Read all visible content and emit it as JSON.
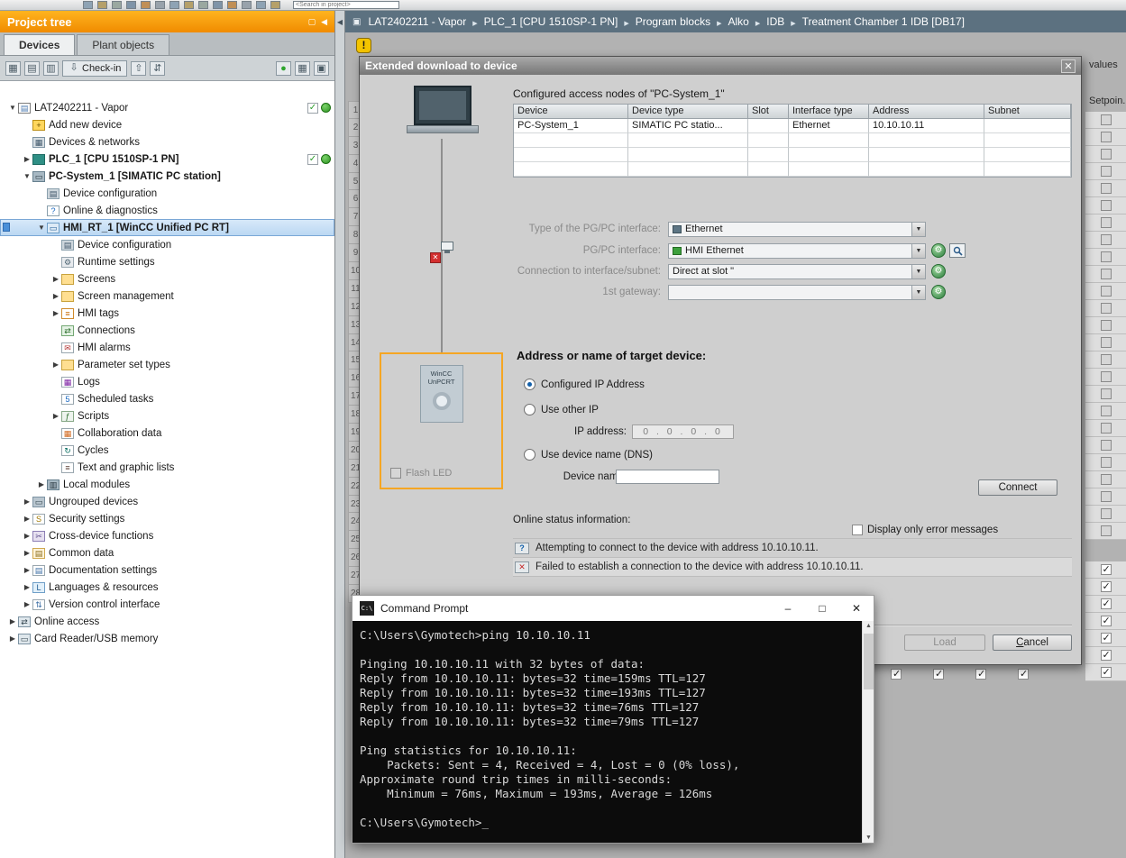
{
  "top_toolbar": {
    "search_placeholder": "<Search in project>",
    "icons": [
      "save-project-icon",
      "print-icon",
      "cut-icon",
      "copy-icon",
      "paste-icon",
      "undo-icon",
      "redo-icon",
      "compile-icon",
      "download-to-device-icon",
      "upload-from-device-icon",
      "start-simulation-icon",
      "go-online-icon",
      "go-offline-icon",
      "diagnostics-icon"
    ]
  },
  "breadcrumb": {
    "items": [
      "LAT2402211 - Vapor",
      "PLC_1 [CPU 1510SP-1 PN]",
      "Program blocks",
      "Alko",
      "IDB",
      "Treatment Chamber 1 IDB [DB17]"
    ]
  },
  "project_tree": {
    "title": "Project tree",
    "tabs": [
      {
        "label": "Devices",
        "active": true
      },
      {
        "label": "Plant objects",
        "active": false
      }
    ],
    "toolbar": {
      "icons_left": [
        "filter-icon",
        "open-element-icon",
        "close-element-icon"
      ],
      "checkin_label": "Check-in",
      "icons_mid": [
        "checkout-icon",
        "sync-icon"
      ],
      "icons_right": [
        "online-status-icon",
        "table-view-icon",
        "window-view-icon"
      ]
    },
    "items": [
      {
        "label": "LAT2402211 - Vapor",
        "level": 0,
        "icon": "project-icon",
        "expander": "expanded",
        "status": [
          "check",
          "circle"
        ]
      },
      {
        "label": "Add new device",
        "level": 1,
        "icon": "add-device-icon"
      },
      {
        "label": "Devices & networks",
        "level": 1,
        "icon": "network-icon"
      },
      {
        "label": "PLC_1 [CPU 1510SP-1 PN]",
        "level": 1,
        "icon": "plc-icon",
        "expander": "collapsed",
        "bold": true,
        "status": [
          "check",
          "circle"
        ]
      },
      {
        "label": "PC-System_1 [SIMATIC PC station]",
        "level": 1,
        "icon": "pc-station-icon",
        "expander": "expanded",
        "bold": true
      },
      {
        "label": "Device configuration",
        "level": 2,
        "icon": "device-config-icon"
      },
      {
        "label": "Online & diagnostics",
        "level": 2,
        "icon": "diagnostics-icon"
      },
      {
        "label": "HMI_RT_1 [WinCC Unified PC RT]",
        "level": 2,
        "icon": "hmi-rt-icon",
        "expander": "expanded",
        "bold": true,
        "selected": true
      },
      {
        "label": "Device configuration",
        "level": 3,
        "icon": "device-config-icon"
      },
      {
        "label": "Runtime settings",
        "level": 3,
        "icon": "runtime-settings-icon"
      },
      {
        "label": "Screens",
        "level": 3,
        "icon": "folder-icon",
        "expander": "collapsed"
      },
      {
        "label": "Screen management",
        "level": 3,
        "icon": "folder-icon",
        "expander": "collapsed"
      },
      {
        "label": "HMI tags",
        "level": 3,
        "icon": "hmi-tags-icon",
        "expander": "collapsed"
      },
      {
        "label": "Connections",
        "level": 3,
        "icon": "connections-icon"
      },
      {
        "label": "HMI alarms",
        "level": 3,
        "icon": "hmi-alarms-icon"
      },
      {
        "label": "Parameter set types",
        "level": 3,
        "icon": "folder-icon",
        "expander": "collapsed"
      },
      {
        "label": "Logs",
        "level": 3,
        "icon": "logs-icon"
      },
      {
        "label": "Scheduled tasks",
        "level": 3,
        "icon": "scheduled-tasks-icon"
      },
      {
        "label": "Scripts",
        "level": 3,
        "icon": "scripts-icon",
        "expander": "collapsed"
      },
      {
        "label": "Collaboration data",
        "level": 3,
        "icon": "collaboration-icon"
      },
      {
        "label": "Cycles",
        "level": 3,
        "icon": "cycles-icon"
      },
      {
        "label": "Text and graphic lists",
        "level": 3,
        "icon": "text-lists-icon"
      },
      {
        "label": "Local modules",
        "level": 2,
        "icon": "local-modules-icon",
        "expander": "collapsed"
      },
      {
        "label": "Ungrouped devices",
        "level": 1,
        "icon": "ungrouped-icon",
        "expander": "collapsed"
      },
      {
        "label": "Security settings",
        "level": 1,
        "icon": "security-icon",
        "expander": "collapsed"
      },
      {
        "label": "Cross-device functions",
        "level": 1,
        "icon": "cross-device-icon",
        "expander": "collapsed"
      },
      {
        "label": "Common data",
        "level": 1,
        "icon": "common-data-icon",
        "expander": "collapsed"
      },
      {
        "label": "Documentation settings",
        "level": 1,
        "icon": "doc-settings-icon",
        "expander": "collapsed"
      },
      {
        "label": "Languages & resources",
        "level": 1,
        "icon": "languages-icon",
        "expander": "collapsed"
      },
      {
        "label": "Version control interface",
        "level": 1,
        "icon": "version-control-icon",
        "expander": "collapsed"
      },
      {
        "label": "Online access",
        "level": 0,
        "icon": "online-access-icon",
        "expander": "collapsed"
      },
      {
        "label": "Card Reader/USB memory",
        "level": 0,
        "icon": "card-reader-icon",
        "expander": "collapsed"
      }
    ]
  },
  "editor": {
    "row_numbers": [
      1,
      2,
      3,
      4,
      5,
      6,
      7,
      8,
      9,
      10,
      11,
      12,
      13,
      14,
      15,
      16,
      17,
      18,
      19,
      20,
      21,
      22,
      23,
      24,
      25,
      26,
      27,
      28
    ],
    "right_panel": {
      "header": "values",
      "subheader": "Setpoin...",
      "unchecked_count": 25,
      "checked_count": 7
    },
    "bottom_checked_count": 4
  },
  "dialog": {
    "title": "Extended download to device",
    "access_nodes_label": "Configured access nodes of \"PC-System_1\"",
    "table": {
      "columns": [
        "Device",
        "Device type",
        "Slot",
        "Interface type",
        "Address",
        "Subnet"
      ],
      "rows": [
        [
          "PC-System_1",
          "SIMATIC PC statio...",
          "",
          "Ethernet",
          "10.10.10.11",
          ""
        ],
        [
          "",
          "",
          "",
          "",
          "",
          ""
        ],
        [
          "",
          "",
          "",
          "",
          "",
          ""
        ],
        [
          "",
          "",
          "",
          "",
          "",
          ""
        ]
      ]
    },
    "fields": [
      {
        "label": "Type of the PG/PC interface:",
        "value": "Ethernet"
      },
      {
        "label": "PG/PC interface:",
        "value": "HMI Ethernet"
      },
      {
        "label": "Connection to interface/subnet:",
        "value": "Direct at slot \""
      },
      {
        "label": "1st gateway:",
        "value": ""
      }
    ],
    "device_box": {
      "device_label": "WinCC UnPCRT",
      "flash_led_label": "Flash LED"
    },
    "target": {
      "heading": "Address or name of target device:",
      "radio_configured": "Configured IP Address",
      "radio_other_ip": "Use other IP",
      "ip_label": "IP address:",
      "ip_value": "0 . 0 . 0 . 0",
      "radio_dns": "Use device name (DNS)",
      "device_name_label": "Device name:",
      "device_name_value": "",
      "connect_label": "Connect"
    },
    "status": {
      "heading": "Online status information:",
      "messages": [
        "Attempting to connect to the device with address 10.10.10.11.",
        "Failed to establish a connection to the device with address 10.10.10.11."
      ],
      "error_only_label": "Display only error messages"
    },
    "buttons": {
      "load": "Load",
      "cancel": "Cancel"
    }
  },
  "cmd": {
    "title": "Command Prompt",
    "lines": [
      "C:\\Users\\Gymotech>ping 10.10.10.11",
      "",
      "Pinging 10.10.10.11 with 32 bytes of data:",
      "Reply from 10.10.10.11: bytes=32 time=159ms TTL=127",
      "Reply from 10.10.10.11: bytes=32 time=193ms TTL=127",
      "Reply from 10.10.10.11: bytes=32 time=76ms TTL=127",
      "Reply from 10.10.10.11: bytes=32 time=79ms TTL=127",
      "",
      "Ping statistics for 10.10.10.11:",
      "    Packets: Sent = 4, Received = 4, Lost = 0 (0% loss),",
      "Approximate round trip times in milli-seconds:",
      "    Minimum = 76ms, Maximum = 193ms, Average = 126ms",
      "",
      "C:\\Users\\Gymotech>_"
    ]
  }
}
